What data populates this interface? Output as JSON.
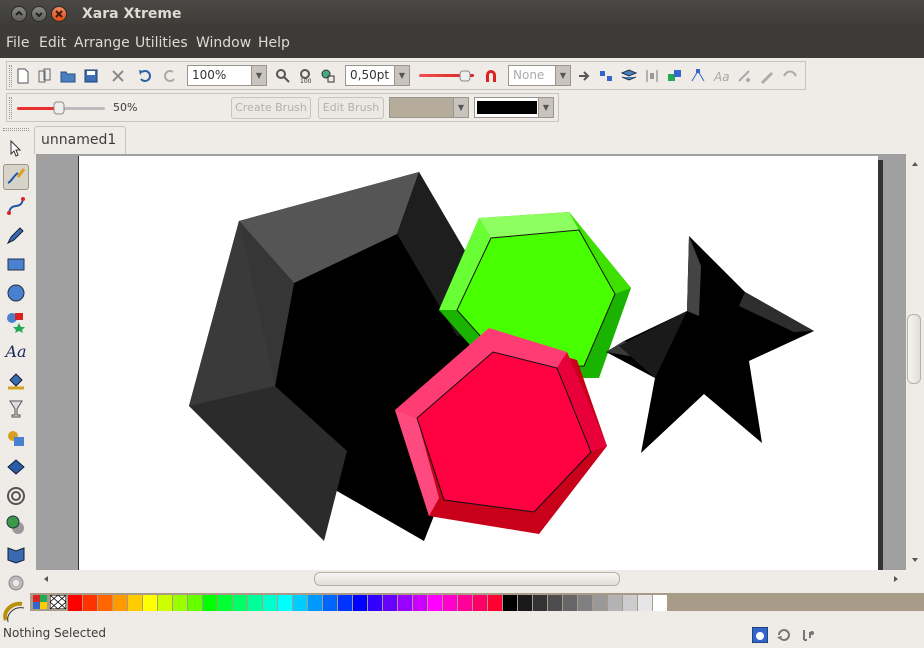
{
  "window": {
    "title": "Xara Xtreme",
    "controls": {
      "close_glyph": "×",
      "minimize_glyph": "⌄",
      "maximize_glyph": "^"
    }
  },
  "menubar": {
    "items": [
      {
        "label": "File"
      },
      {
        "label": "Edit"
      },
      {
        "label": "Arrange"
      },
      {
        "label": "Utilities"
      },
      {
        "label": "Window"
      },
      {
        "label": "Help"
      }
    ]
  },
  "toolbar": {
    "zoom_value": "100%",
    "line_width_value": "0,50pt",
    "arrowhead_value": "None"
  },
  "brush_bar": {
    "slider_value_label": "50%",
    "slider_fraction": 0.5,
    "create_brush_label": "Create Brush",
    "edit_brush_label": "Edit Brush"
  },
  "document": {
    "tab_label": "unnamed1 *"
  },
  "palette": {
    "colors": [
      "#ff0000",
      "#ff3300",
      "#ff6600",
      "#ff9900",
      "#ffcc00",
      "#ffff00",
      "#ccff00",
      "#99ff00",
      "#66ff00",
      "#00ff00",
      "#00ff33",
      "#00ff66",
      "#00ff99",
      "#00ffcc",
      "#00ffff",
      "#00ccff",
      "#0099ff",
      "#0066ff",
      "#0033ff",
      "#0000ff",
      "#3300ff",
      "#6600ff",
      "#9900ff",
      "#cc00ff",
      "#ff00ff",
      "#ff00cc",
      "#ff0099",
      "#ff0066",
      "#ff0033",
      "#000000",
      "#1a1a1a",
      "#333333",
      "#4d4d4d",
      "#666666",
      "#808080",
      "#999999",
      "#b3b3b3",
      "#cccccc",
      "#e6e6e6",
      "#ffffff"
    ]
  },
  "status": {
    "text": "Nothing Selected"
  },
  "colors": {
    "shape_green": "#47ff00",
    "shape_red": "#ff0040",
    "shape_black": "#000000",
    "title_bg": "#3c3b37",
    "accent_orange": "#df4b13"
  }
}
